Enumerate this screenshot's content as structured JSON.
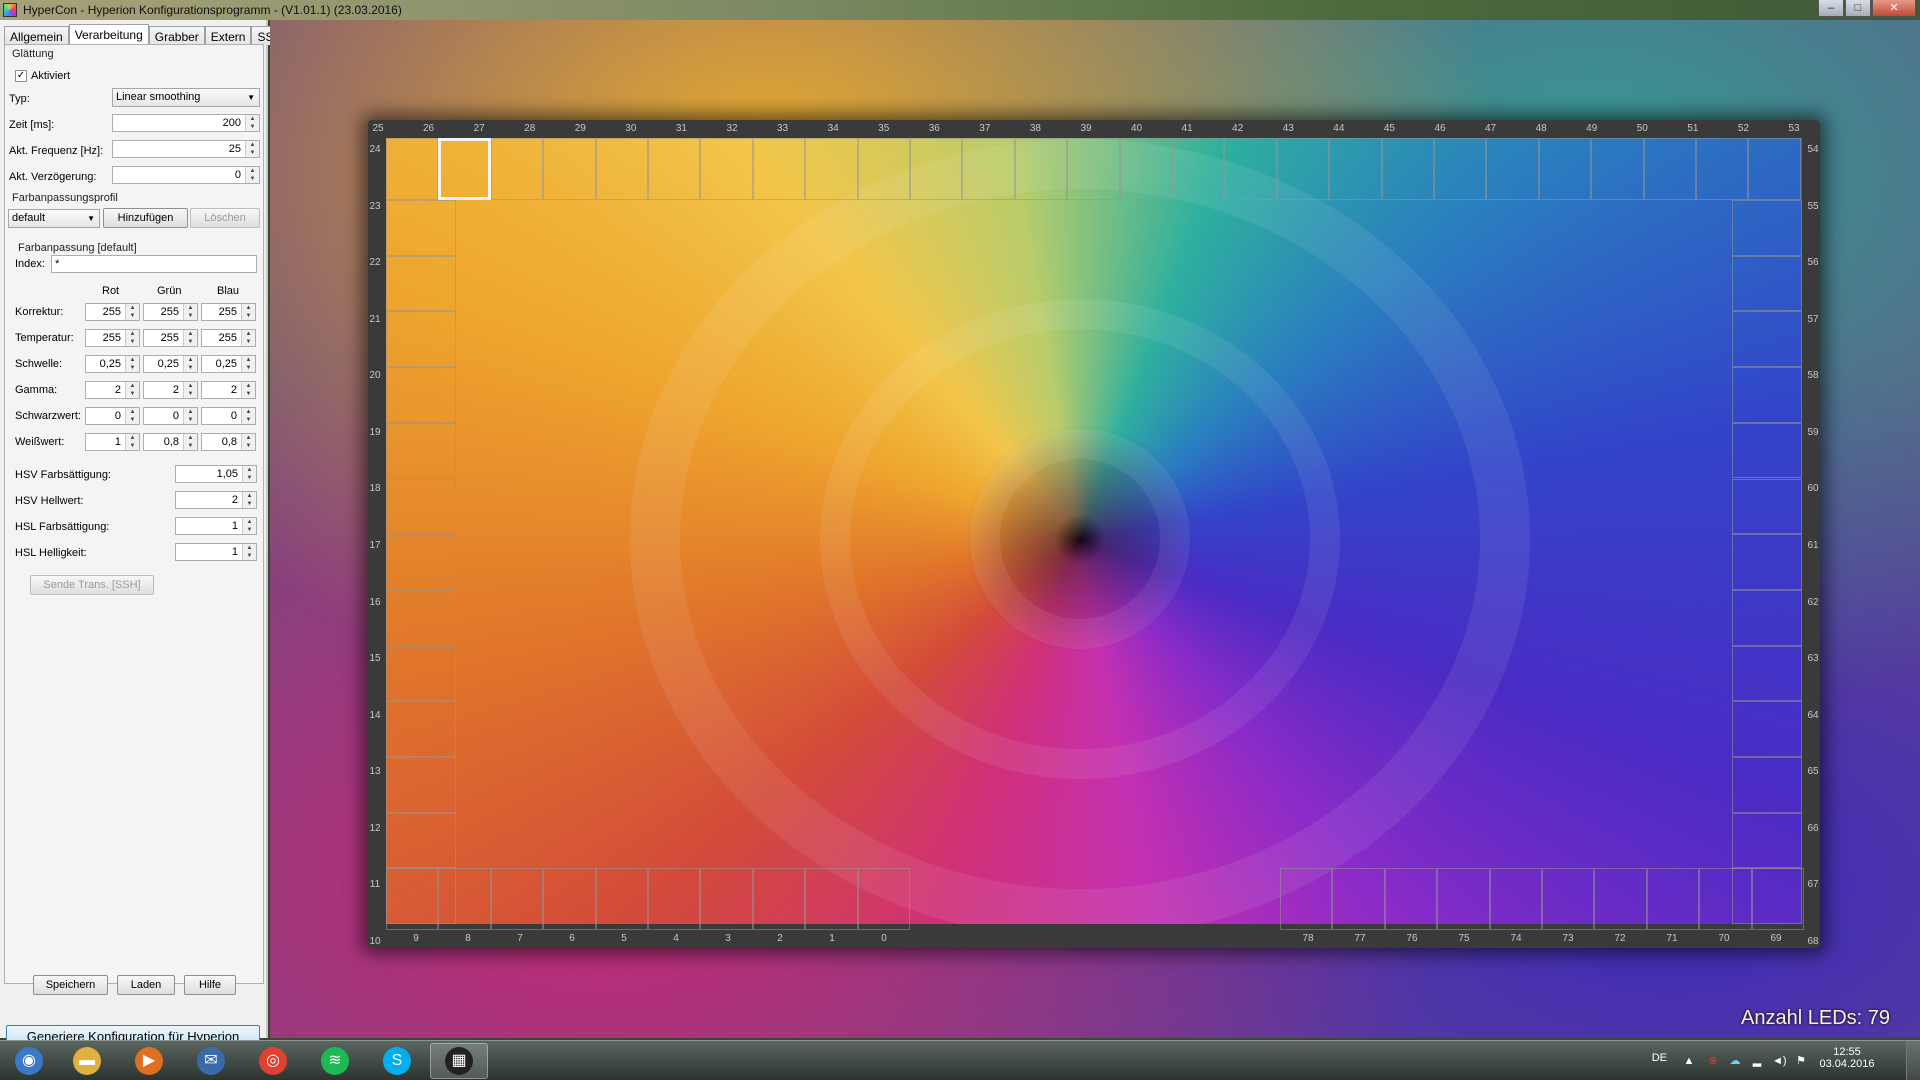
{
  "window": {
    "title": "HyperCon - Hyperion Konfigurationsprogramm - (V1.01.1) (23.03.2016)",
    "controls": [
      "–",
      "□",
      "✕"
    ]
  },
  "tabs": [
    "Allgemein",
    "Verarbeitung",
    "Grabber",
    "Extern",
    "SSH"
  ],
  "smoothing": {
    "group_label": "Glättung",
    "enabled_label": "Aktiviert",
    "enabled": true,
    "type_label": "Typ:",
    "type_value": "Linear smoothing",
    "time_label": "Zeit [ms]:",
    "time_value": "200",
    "freq_label": "Akt. Frequenz [Hz]:",
    "freq_value": "25",
    "delay_label": "Akt. Verzögerung:",
    "delay_value": "0"
  },
  "profile": {
    "group_label": "Farbanpassungsprofil",
    "selected": "default",
    "add_label": "Hinzufügen",
    "delete_label": "Löschen"
  },
  "color": {
    "group_label": "Farbanpassung [default]",
    "index_label": "Index:",
    "index_value": "*",
    "col_headers": [
      "Rot",
      "Grün",
      "Blau"
    ],
    "rows": [
      {
        "label": "Korrektur:",
        "values": [
          "255",
          "255",
          "255"
        ]
      },
      {
        "label": "Temperatur:",
        "values": [
          "255",
          "255",
          "255"
        ]
      },
      {
        "label": "Schwelle:",
        "values": [
          "0,25",
          "0,25",
          "0,25"
        ]
      },
      {
        "label": "Gamma:",
        "values": [
          "2",
          "2",
          "2"
        ]
      },
      {
        "label": "Schwarzwert:",
        "values": [
          "0",
          "0",
          "0"
        ]
      },
      {
        "label": "Weißwert:",
        "values": [
          "1",
          "0,8",
          "0,8"
        ]
      }
    ],
    "hsv_sat_label": "HSV Farbsättigung:",
    "hsv_sat_value": "1,05",
    "hsv_val_label": "HSV Hellwert:",
    "hsv_val_value": "2",
    "hsl_sat_label": "HSL Farbsättigung:",
    "hsl_sat_value": "1",
    "hsl_light_label": "HSL Helligkeit:",
    "hsl_light_value": "1",
    "send_label": "Sende Trans. [SSH]"
  },
  "footer": {
    "save_label": "Speichern",
    "load_label": "Laden",
    "help_label": "Hilfe",
    "generate_label": "Generiere Konfiguration für Hyperion"
  },
  "preview": {
    "top_ticks": [
      "25",
      "26",
      "27",
      "28",
      "29",
      "30",
      "31",
      "32",
      "33",
      "34",
      "35",
      "36",
      "37",
      "38",
      "39",
      "40",
      "41",
      "42",
      "43",
      "44",
      "45",
      "46",
      "47",
      "48",
      "49",
      "50",
      "51",
      "52",
      "53"
    ],
    "left_ticks": [
      "24",
      "23",
      "22",
      "21",
      "20",
      "19",
      "18",
      "17",
      "16",
      "15",
      "14",
      "13",
      "12",
      "11",
      "10"
    ],
    "right_ticks": [
      "54",
      "55",
      "56",
      "57",
      "58",
      "59",
      "60",
      "61",
      "62",
      "63",
      "64",
      "65",
      "66",
      "67",
      "68"
    ],
    "bottom_left_ticks": [
      "9",
      "8",
      "7",
      "6",
      "5",
      "4",
      "3",
      "2",
      "1",
      "0"
    ],
    "bottom_right_ticks": [
      "78",
      "77",
      "76",
      "75",
      "74",
      "73",
      "72",
      "71",
      "70",
      "69"
    ],
    "led_count_label": "Anzahl LEDs: 79"
  },
  "taskbar": {
    "language": "DE",
    "time": "12:55",
    "date": "03.04.2016",
    "apps": [
      {
        "name": "start",
        "glyph": "◉"
      },
      {
        "name": "explorer",
        "glyph": "▬"
      },
      {
        "name": "media-player",
        "glyph": "▶"
      },
      {
        "name": "thunderbird",
        "glyph": "✉"
      },
      {
        "name": "chrome",
        "glyph": "◎"
      },
      {
        "name": "spotify",
        "glyph": "≋"
      },
      {
        "name": "skype",
        "glyph": "S"
      },
      {
        "name": "hypercon",
        "glyph": "▦"
      }
    ]
  }
}
